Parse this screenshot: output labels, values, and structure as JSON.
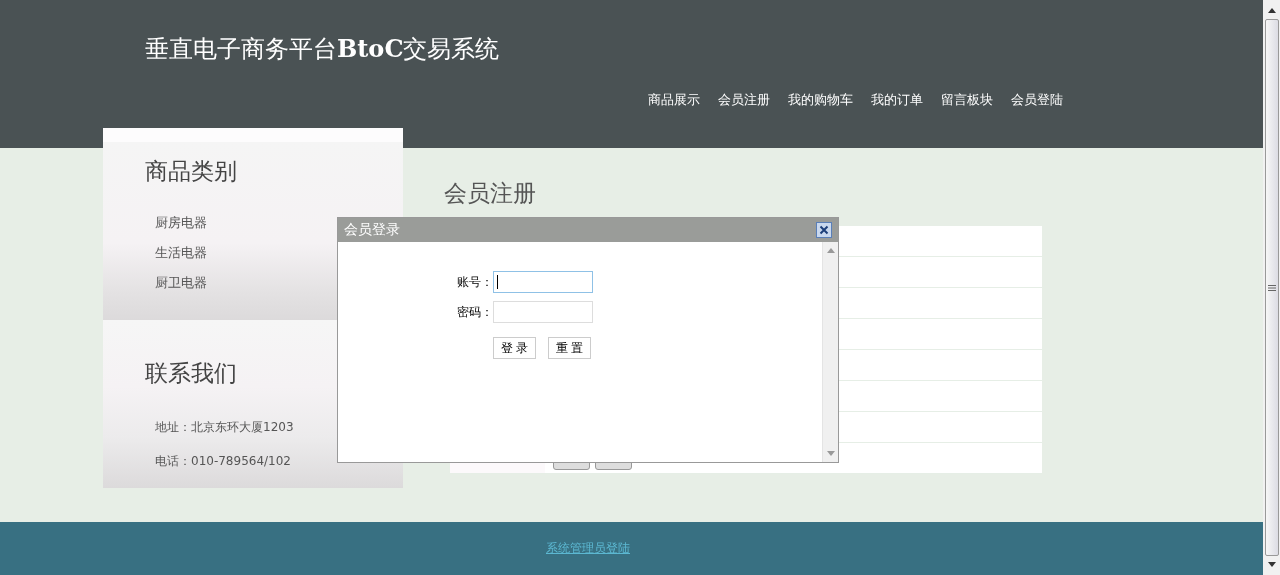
{
  "header": {
    "title": "垂直电子商务平台**BtoC**交易系统",
    "nav": [
      "商品展示",
      "会员注册",
      "我的购物车",
      "我的订单",
      "留言板块",
      "会员登陆"
    ]
  },
  "sidebar": [
    {
      "heading": "商品类别",
      "items": [
        "厨房电器",
        "生活电器",
        "厨卫电器"
      ]
    },
    {
      "heading": "联系我们",
      "items": [
        "地址：北京东环大厦1203",
        "电话：010-789564/102"
      ]
    }
  ],
  "content": {
    "title": "会员注册"
  },
  "dialog": {
    "title": "会员登录",
    "fields": [
      {
        "label": "账号：",
        "focused": true
      },
      {
        "label": "密码：",
        "focused": false
      }
    ],
    "buttons": [
      "登 录",
      "重 置"
    ]
  },
  "footer": {
    "link": "系统管理员登陆"
  }
}
